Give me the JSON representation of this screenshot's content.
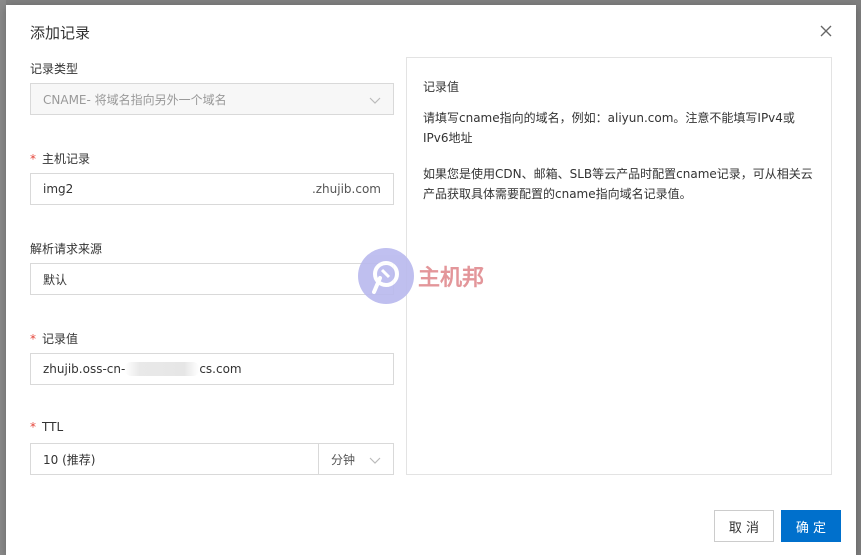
{
  "dialog": {
    "title": "添加记录"
  },
  "form": {
    "record_type": {
      "label": "记录类型",
      "value": "CNAME- 将域名指向另外一个域名"
    },
    "host_record": {
      "label": "主机记录",
      "value": "img2",
      "suffix": ".zhujib.com"
    },
    "resolve_source": {
      "label": "解析请求来源",
      "value": "默认"
    },
    "record_value": {
      "label": "记录值",
      "value_prefix": "zhujib.oss-cn-",
      "value_suffix": "cs.com"
    },
    "ttl": {
      "label": "TTL",
      "value": "10 (推荐)",
      "unit": "分钟"
    },
    "required_mark": "*"
  },
  "help_panel": {
    "title": "记录值",
    "line1": "请填写cname指向的域名，例如：aliyun.com。注意不能填写IPv4或IPv6地址",
    "line2": "如果您是使用CDN、邮箱、SLB等云产品时配置cname记录，可从相关云产品获取具体需要配置的cname指向域名记录值。"
  },
  "buttons": {
    "cancel": "取 消",
    "ok": "确 定"
  },
  "watermark": {
    "text": "主机邦"
  },
  "colors": {
    "primary": "#0070cc",
    "required": "#e5463b",
    "watermark_circle": "#b9b9ee",
    "watermark_text": "#e08b90"
  }
}
